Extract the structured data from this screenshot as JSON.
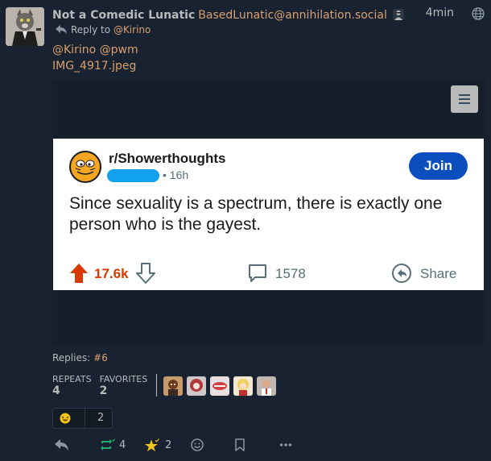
{
  "author": {
    "display_name": "Not a Comedic Lunatic",
    "acct": "BasedLunatic@annihilation.social"
  },
  "timestamp": "4min",
  "reply": {
    "prefix": "Reply to",
    "to": "@Kirino"
  },
  "content": {
    "mentions": "@Kirino @pwm",
    "attachment_name": "IMG_4917.jpeg"
  },
  "screenshot": {
    "subreddit": "r/Showerthoughts",
    "age": "• 16h",
    "join_label": "Join",
    "title": "Since sexuality is a spectrum, there is exactly one person who is the gayest.",
    "upvotes": "17.6k",
    "comments": "1578",
    "share_label": "Share"
  },
  "replies": {
    "label": "Replies:",
    "value": "#6"
  },
  "stats": {
    "repeats_label": "REPEATS",
    "repeats_value": "4",
    "favorites_label": "FAVORITES",
    "favorites_value": "2"
  },
  "reaction": {
    "emoji": "grinning-squint-face",
    "count": "2"
  },
  "actions": {
    "repeat_count": "4",
    "favorite_count": "2"
  },
  "colors": {
    "link": "#d8a070",
    "repeat_active": "#1fab72",
    "favorite_active": "#f5c518",
    "reddit_join": "#0a4fbd",
    "reddit_upvote": "#d93a00"
  }
}
